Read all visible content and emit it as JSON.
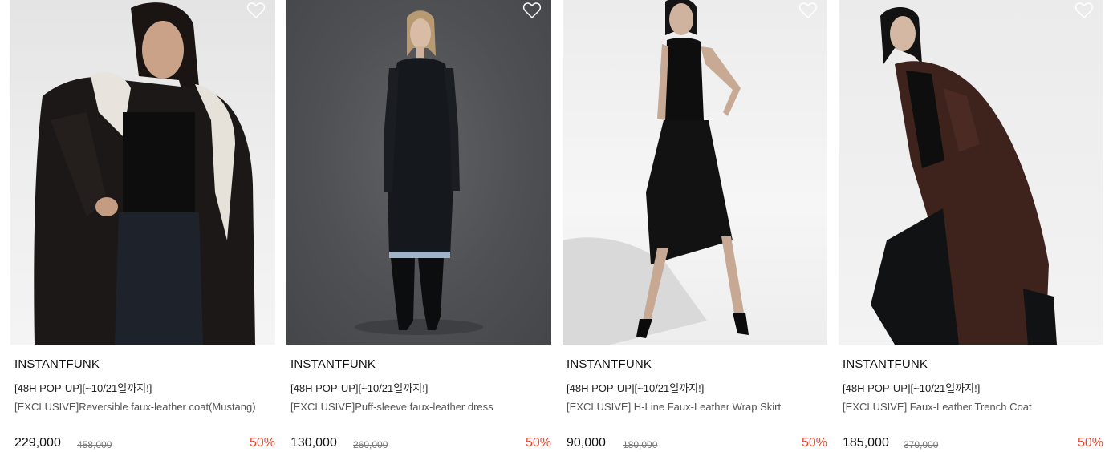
{
  "products": [
    {
      "brand": "INSTANTFUNK",
      "promo": "[48H POP-UP][~10/21일까지!]",
      "name": "[EXCLUSIVE]Reversible faux-leather coat(Mustang)",
      "price": "229,000",
      "original_price": "458,000",
      "discount": "50%",
      "image_alt": "model wearing black reversible faux-leather shearling coat"
    },
    {
      "brand": "INSTANTFUNK",
      "promo": "[48H POP-UP][~10/21일까지!]",
      "name": "[EXCLUSIVE]Puff-sleeve faux-leather dress",
      "price": "130,000",
      "original_price": "260,000",
      "discount": "50%",
      "image_alt": "model wearing black puff-sleeve faux-leather dress and slouch boots"
    },
    {
      "brand": "INSTANTFUNK",
      "promo": "[48H POP-UP][~10/21일까지!]",
      "name": "[EXCLUSIVE] H-Line Faux-Leather Wrap Skirt",
      "price": "90,000",
      "original_price": "180,000",
      "discount": "50%",
      "image_alt": "model wearing black tank top and faux-leather wrap skirt"
    },
    {
      "brand": "INSTANTFUNK",
      "promo": "[48H POP-UP][~10/21일까지!]",
      "name": "[EXCLUSIVE] Faux-Leather Trench Coat",
      "price": "185,000",
      "original_price": "370,000",
      "discount": "50%",
      "image_alt": "model wearing brown faux-leather trench coat"
    }
  ],
  "colors": {
    "discount": "#e8472c",
    "text": "#111111",
    "muted": "#555555"
  },
  "icons": {
    "wishlist": "heart-outline-icon"
  }
}
